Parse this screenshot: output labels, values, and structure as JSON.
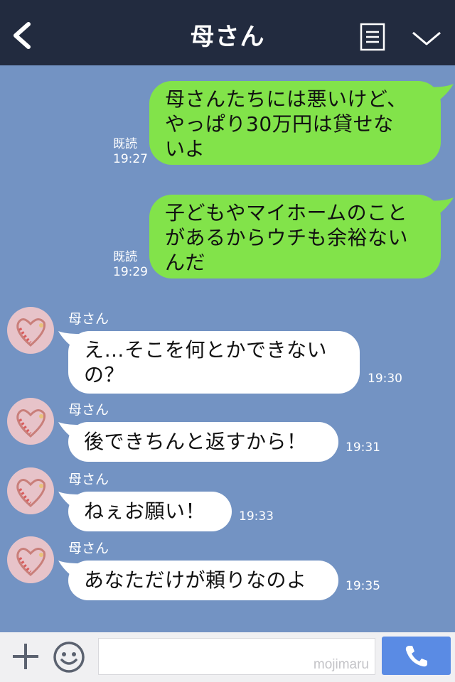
{
  "header": {
    "title": "母さん",
    "back_icon": "chevron-left-icon",
    "menu_icon": "menu-list-icon",
    "expand_icon": "chevron-down-icon",
    "background": "#222b3f"
  },
  "chat": {
    "background": "#7393c3",
    "messages": [
      {
        "direction": "outgoing",
        "lines": [
          "母さんたちには悪いけど、",
          "やっぱり30万円は貸せな",
          "いよ"
        ],
        "read": "既読",
        "time": "19:27"
      },
      {
        "direction": "outgoing",
        "lines": [
          "子どもやマイホームのこと",
          "があるからウチも余裕ない",
          "んだ"
        ],
        "read": "既読",
        "time": "19:29"
      },
      {
        "direction": "incoming",
        "sender": "母さん",
        "lines": [
          "え…そこを何とかできない",
          "の？"
        ],
        "time": "19:30"
      },
      {
        "direction": "incoming",
        "sender": "母さん",
        "lines": [
          "後できちんと返すから！"
        ],
        "time": "19:31"
      },
      {
        "direction": "incoming",
        "sender": "母さん",
        "lines": [
          "ねぇお願い！"
        ],
        "time": "19:33"
      },
      {
        "direction": "incoming",
        "sender": "母さん",
        "lines": [
          "あなただけが頼りなのよ"
        ],
        "time": "19:35"
      }
    ],
    "outgoing_color": "#82e34a",
    "incoming_color": "#ffffff"
  },
  "footer": {
    "plus_icon": "plus-icon",
    "sticker_icon": "smile-icon",
    "input_placeholder": "",
    "watermark": "mojimaru",
    "call_icon": "phone-icon",
    "call_button_color": "#5a8be4"
  }
}
